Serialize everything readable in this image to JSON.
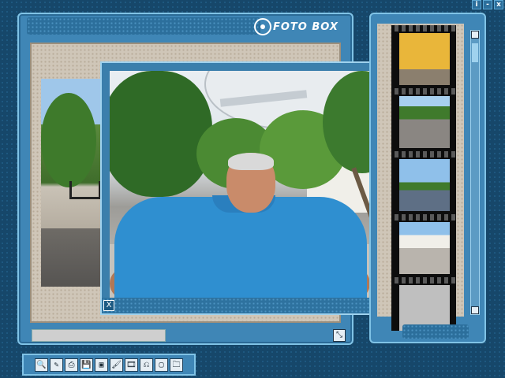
{
  "window_controls": {
    "info": "i",
    "minimize": "-",
    "close": "x"
  },
  "app": {
    "logo_text": "FOTO BOX"
  },
  "viewer": {
    "close_label": "X"
  },
  "statusbar": {
    "grip_glyph": "⤡"
  },
  "toolbar": {
    "tools": [
      {
        "name": "zoom-tool",
        "glyph": "🔍"
      },
      {
        "name": "edit-tool",
        "glyph": "✎"
      },
      {
        "name": "print-tool",
        "glyph": "⎙"
      },
      {
        "name": "save-tool",
        "glyph": "💾"
      },
      {
        "name": "export-tool",
        "glyph": "▣"
      },
      {
        "name": "brush-tool",
        "glyph": "🖌"
      },
      {
        "name": "slideshow-tool",
        "glyph": "🎞"
      },
      {
        "name": "stamp-tool",
        "glyph": "⎌"
      },
      {
        "name": "frame-tool",
        "glyph": "▢"
      },
      {
        "name": "open-tool",
        "glyph": "🗀"
      }
    ]
  },
  "thumbnails": [
    {
      "name": "thumbnail-1"
    },
    {
      "name": "thumbnail-2"
    },
    {
      "name": "thumbnail-3"
    },
    {
      "name": "thumbnail-4"
    },
    {
      "name": "thumbnail-5"
    }
  ]
}
